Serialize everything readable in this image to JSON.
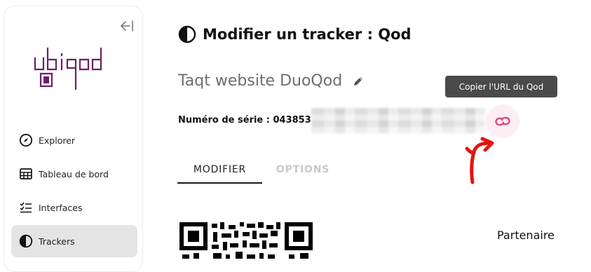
{
  "brand": {
    "logo_text": "ubiqod",
    "accent": "#6b1f6b"
  },
  "sidebar": {
    "collapse_icon": "collapse-left-icon",
    "items": [
      {
        "label": "Explorer",
        "icon": "compass-icon",
        "active": false
      },
      {
        "label": "Tableau de bord",
        "icon": "dashboard-icon",
        "active": false
      },
      {
        "label": "Interfaces",
        "icon": "checklist-icon",
        "active": false
      },
      {
        "label": "Trackers",
        "icon": "half-circle-icon",
        "active": true
      }
    ]
  },
  "header": {
    "title": "Modifier un tracker : Qod",
    "icon": "half-circle-icon"
  },
  "tracker": {
    "name": "Taqt website DuoQod",
    "serial_label": "Numéro de série : 043853",
    "copy_url_tooltip": "Copier l'URL du Qod"
  },
  "tabs": [
    {
      "label": "MODIFIER",
      "active": true
    },
    {
      "label": "OPTIONS",
      "active": false
    }
  ],
  "partner_label": "Partenaire",
  "colors": {
    "link_pink": "#e0497a",
    "annotation_red": "#e41414",
    "active_nav_bg": "#e4e4e4"
  }
}
